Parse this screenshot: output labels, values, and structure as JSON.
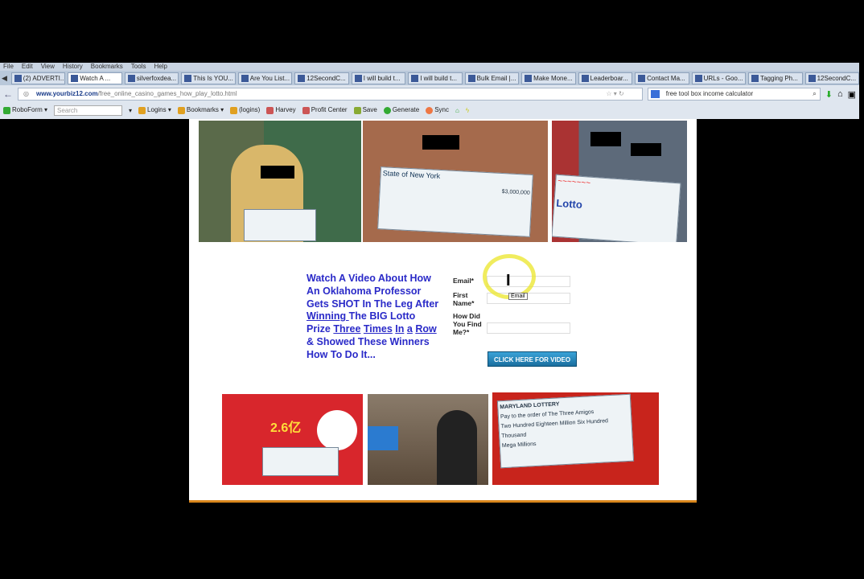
{
  "menu": [
    "File",
    "Edit",
    "View",
    "History",
    "Bookmarks",
    "Tools",
    "Help"
  ],
  "tabs": [
    {
      "label": "(2) ADVERTI...",
      "active": false
    },
    {
      "label": "Watch A ...",
      "active": true
    },
    {
      "label": "silverfoxdea...",
      "active": false
    },
    {
      "label": "This Is YOU...",
      "active": false
    },
    {
      "label": "Are You List...",
      "active": false
    },
    {
      "label": "12SecondC...",
      "active": false
    },
    {
      "label": "I will build t...",
      "active": false
    },
    {
      "label": "I will build t...",
      "active": false
    },
    {
      "label": "Bulk Email |...",
      "active": false
    },
    {
      "label": "Make Mone...",
      "active": false
    },
    {
      "label": "Leaderboar...",
      "active": false
    },
    {
      "label": "Contact Ma...",
      "active": false
    },
    {
      "label": "URLs - Goo...",
      "active": false
    },
    {
      "label": "Tagging Ph...",
      "active": false
    },
    {
      "label": "12SecondC...",
      "active": false
    }
  ],
  "url": {
    "domain": "www.yourbiz12.com",
    "path": "/free_online_casino_games_how_play_lotto.html"
  },
  "search_value": "free tool box income calculator",
  "bookmarks": {
    "roboform": "RoboForm ▾",
    "search_placeholder": "Search",
    "items": [
      "Logins ▾",
      "Bookmarks ▾",
      "(logins)",
      "Harvey",
      "Profit Center",
      "Save",
      "Generate",
      "Sync"
    ]
  },
  "photos": {
    "ny_check_title": "State of New York",
    "ny_check_amount": "$3,000,000",
    "lotto_label": "Lotto",
    "md_title": "MARYLAND LOTTERY",
    "md_payee": "Pay to the order of The Three Amigos",
    "md_amount": "Two Hundred Eighteen Million Six Hundred Thousand",
    "md_memo": "Mega Millions",
    "cn_amount": "2.6亿"
  },
  "headline": {
    "l1": "Watch A Video About How",
    "l2": "An Oklahoma Professor",
    "l3": "Gets SHOT In The Leg After",
    "w_winning": "Winning ",
    "l4b": "The BIG Lotto",
    "p": "Prize ",
    "three": "Three",
    "times": "Times",
    "in": "In",
    "a": "a",
    "row": "Row",
    "l6": "& Showed These Winners",
    "l7": "How To Do It..."
  },
  "form": {
    "email_label": "Email*",
    "first_name_label": "First Name*",
    "how_label": "How Did You Find Me?*",
    "tooltip": "Email",
    "submit": "CLICK HERE FOR VIDEO"
  }
}
